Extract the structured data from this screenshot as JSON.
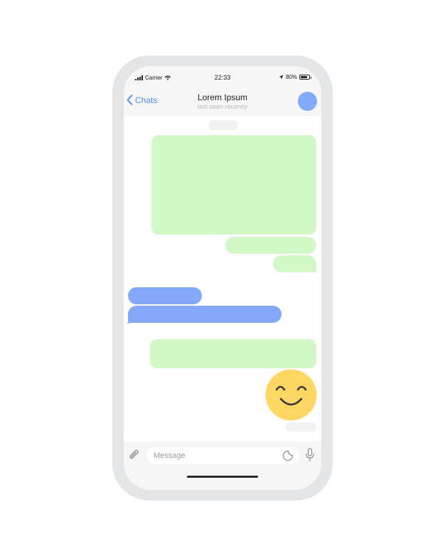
{
  "status_bar": {
    "carrier": "Carrier",
    "time": "22:33",
    "battery": "80%",
    "battery_level": 0.8
  },
  "header": {
    "back_label": "Chats",
    "contact_name": "Lorem Ipsum",
    "last_seen": "last seen recently"
  },
  "composer": {
    "placeholder": "Message"
  },
  "colors": {
    "outgoing": "#d2f8c8",
    "incoming": "#83a8f8",
    "accent": "#4f8cf0",
    "emoji": "#fdd663"
  },
  "icons": [
    "wifi-icon",
    "location-arrow-icon",
    "back-chevron-icon",
    "paperclip-icon",
    "sticker-icon",
    "microphone-icon",
    "smiling-face-emoji"
  ]
}
